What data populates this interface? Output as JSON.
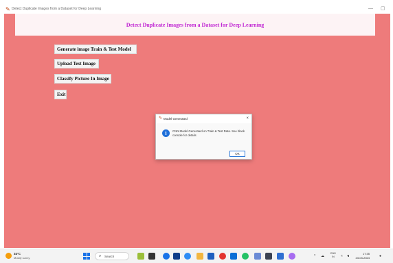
{
  "window": {
    "title": "Detect Duplicate Images from a Dataset for Deep Learning",
    "minimize_glyph": "—",
    "maximize_glyph": "▢"
  },
  "header": {
    "title": "Detect Duplicate Images from a Dataset for Deep Learning"
  },
  "buttons": {
    "generate": "Generate image Train & Test Model",
    "upload": "Upload Test Image",
    "classify": "Classify Picture In Image",
    "exit": "Exit"
  },
  "dialog": {
    "title": "Model Generated",
    "close_glyph": "×",
    "info_glyph": "i",
    "message": "CNN Model Generated on Train & Test Data. See black console for details",
    "ok_label": "OK"
  },
  "taskbar": {
    "temperature": "34°C",
    "weather": "Mostly sunny",
    "search_placeholder": "Search",
    "apps": [
      "pumpkin-app-icon",
      "file-explorer-icon",
      "photos-icon",
      "store-icon",
      "chrome-icon",
      "folder-icon",
      "word-icon",
      "opera-icon",
      "outlook-icon",
      "whatsapp-icon",
      "notepad-icon",
      "terminal-icon",
      "powerpoint-icon",
      "settings-icon"
    ],
    "lang_line1": "ENG",
    "lang_line2": "IN",
    "time": "17:35",
    "date": "23-03-2024"
  },
  "colors": {
    "app_background": "#ee7b7b",
    "header_background": "#fdf3f5",
    "header_text": "#c026d3",
    "accent_blue": "#1e6fd9"
  }
}
